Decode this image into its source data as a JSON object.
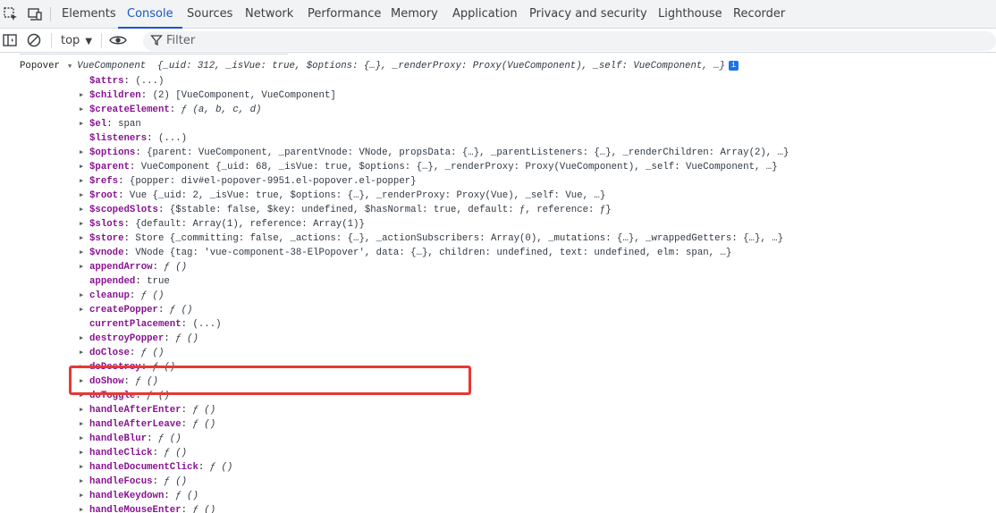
{
  "tabs": [
    {
      "label": "Elements",
      "active": false
    },
    {
      "label": "Console",
      "active": true
    },
    {
      "label": "Sources",
      "active": false
    },
    {
      "label": "Network",
      "active": false
    },
    {
      "label": "Performance",
      "active": false
    },
    {
      "label": "Memory",
      "active": false
    },
    {
      "label": "Application",
      "active": false
    },
    {
      "label": "Privacy and security",
      "active": false
    },
    {
      "label": "Lighthouse",
      "active": false
    },
    {
      "label": "Recorder",
      "active": false
    }
  ],
  "toolbar": {
    "context": "top",
    "filter_placeholder": "Filter"
  },
  "log": {
    "source": "Popover",
    "head_class": "VueComponent",
    "head_preview": "{_uid: 312, _isVue: true, $options: {…}, _renderProxy: Proxy(VueComponent), _self: VueComponent, …}",
    "info_glyph": "i"
  },
  "props": [
    {
      "key": "$attrs",
      "value": "(...)",
      "expandable": false
    },
    {
      "key": "$children",
      "value": "(2) [VueComponent, VueComponent]",
      "expandable": true
    },
    {
      "key": "$createElement",
      "value": "ƒ (a, b, c, d)",
      "expandable": true
    },
    {
      "key": "$el",
      "value": "span",
      "expandable": true
    },
    {
      "key": "$listeners",
      "value": "(...)",
      "expandable": false
    },
    {
      "key": "$options",
      "value": "{parent: VueComponent, _parentVnode: VNode, propsData: {…}, _parentListeners: {…}, _renderChildren: Array(2), …}",
      "expandable": true
    },
    {
      "key": "$parent",
      "value": "VueComponent {_uid: 68, _isVue: true, $options: {…}, _renderProxy: Proxy(VueComponent), _self: VueComponent, …}",
      "expandable": true
    },
    {
      "key": "$refs",
      "value": "{popper: div#el-popover-9951.el-popover.el-popper}",
      "expandable": true
    },
    {
      "key": "$root",
      "value": "Vue {_uid: 2, _isVue: true, $options: {…}, _renderProxy: Proxy(Vue), _self: Vue, …}",
      "expandable": true
    },
    {
      "key": "$scopedSlots",
      "value": "{$stable: false, $key: undefined, $hasNormal: true, default: ƒ, reference: ƒ}",
      "expandable": true
    },
    {
      "key": "$slots",
      "value": "{default: Array(1), reference: Array(1)}",
      "expandable": true
    },
    {
      "key": "$store",
      "value": "Store {_committing: false, _actions: {…}, _actionSubscribers: Array(0), _mutations: {…}, _wrappedGetters: {…}, …}",
      "expandable": true
    },
    {
      "key": "$vnode",
      "value": "VNode {tag: 'vue-component-38-ElPopover', data: {…}, children: undefined, text: undefined, elm: span, …}",
      "expandable": true
    },
    {
      "key": "appendArrow",
      "value": "ƒ ()",
      "expandable": true
    },
    {
      "key": "appended",
      "value": "true",
      "expandable": false
    },
    {
      "key": "cleanup",
      "value": "ƒ ()",
      "expandable": true
    },
    {
      "key": "createPopper",
      "value": "ƒ ()",
      "expandable": true
    },
    {
      "key": "currentPlacement",
      "value": "(...)",
      "expandable": false
    },
    {
      "key": "destroyPopper",
      "value": "ƒ ()",
      "expandable": true
    },
    {
      "key": "doClose",
      "value": "ƒ ()",
      "expandable": true
    },
    {
      "key": "doDestroy",
      "value": "ƒ ()",
      "expandable": true
    },
    {
      "key": "doShow",
      "value": "ƒ ()",
      "expandable": true
    },
    {
      "key": "doToggle",
      "value": "ƒ ()",
      "expandable": true
    },
    {
      "key": "handleAfterEnter",
      "value": "ƒ ()",
      "expandable": true
    },
    {
      "key": "handleAfterLeave",
      "value": "ƒ ()",
      "expandable": true
    },
    {
      "key": "handleBlur",
      "value": "ƒ ()",
      "expandable": true
    },
    {
      "key": "handleClick",
      "value": "ƒ ()",
      "expandable": true
    },
    {
      "key": "handleDocumentClick",
      "value": "ƒ ()",
      "expandable": true
    },
    {
      "key": "handleFocus",
      "value": "ƒ ()",
      "expandable": true
    },
    {
      "key": "handleKeydown",
      "value": "ƒ ()",
      "expandable": true
    },
    {
      "key": "handleMouseEnter",
      "value": "ƒ ()",
      "expandable": true
    }
  ],
  "colors": {
    "accent": "#1a56c9",
    "key": "#881391",
    "highlight_box": "#e53935"
  }
}
